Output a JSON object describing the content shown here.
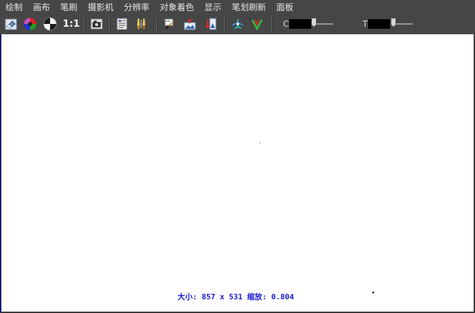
{
  "menubar": {
    "items": [
      {
        "label": "绘制"
      },
      {
        "label": "画布"
      },
      {
        "label": "笔刷"
      },
      {
        "label": "摄影机"
      },
      {
        "label": "分辨率"
      },
      {
        "label": "对象着色"
      },
      {
        "label": "显示"
      },
      {
        "label": "笔划刷新"
      },
      {
        "label": "面板"
      }
    ]
  },
  "toolbar": {
    "ratio_label": "1:1",
    "icons": [
      "eraser-icon",
      "color-wheel-icon",
      "contrast-icon",
      "ratio-1-1",
      "camera-icon",
      "properties-icon",
      "brush-tools-icon",
      "paint-brush-icon",
      "export-image-icon",
      "import-icon",
      "fit-view-icon",
      "reset-view-icon"
    ],
    "slider_c": {
      "label": "C",
      "level": 0.1
    },
    "slider_t": {
      "label": "T",
      "level": 0.1
    }
  },
  "canvas": {
    "status_text": "大小: 857 x 531 缩放: 0.804",
    "background": "#ffffff",
    "status_color": "#1a1ad0"
  }
}
